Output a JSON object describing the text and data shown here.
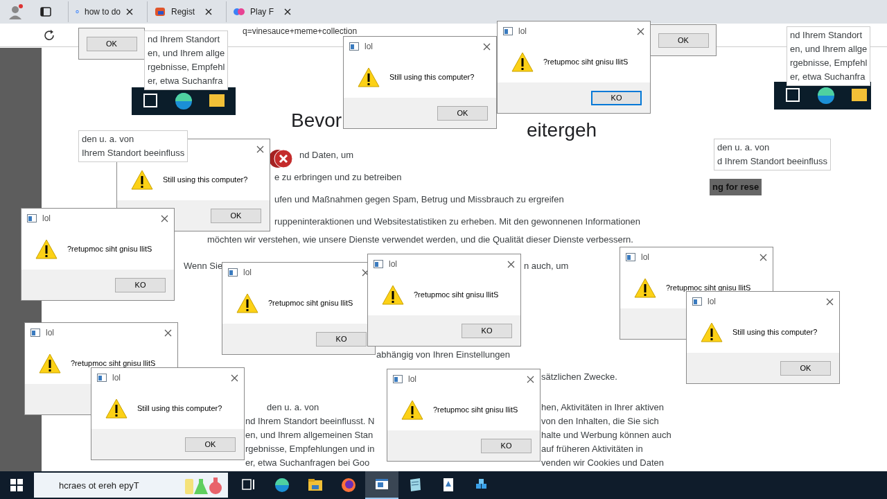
{
  "browser": {
    "tabs": [
      {
        "label": "how to do",
        "selected": false
      },
      {
        "label": "Regist",
        "selected": false
      },
      {
        "label": "Play F",
        "selected": false
      }
    ],
    "address": "q=vinesauce+meme+collection",
    "heading": "Bevor",
    "heading_tail": "eitergeh",
    "page_texts": [
      "nd Daten, um",
      "e zu erbringen und zu betreiben",
      "ufen und Maßnahmen gegen Spam, Betrug und Missbrauch zu ergreifen",
      "ruppeninteraktionen und Websitestatistiken zu erheben. Mit den gewonnenen Informationen",
      "möchten wir verstehen, wie unsere Dienste verwendet werden, und die Qualität dieser Dienste verbessern.",
      "Wenn Sie",
      "n auch, um",
      "abhängig von Ihren Einstellungen",
      "sätzlichen Zwecke.",
      "den u. a. von",
      "hen, Aktivitäten in Ihrer aktiven",
      "nd Ihrem Standort beeinflusst. N",
      "von den Inhalten, die Sie sich",
      "en, und Ihrem allgemeinen Stan",
      "halte und Werbung können auch",
      "rgebnisse, Empfehlungen und in",
      "auf früheren Aktivitäten in",
      "er, etwa Suchanfragen bei Goo",
      "venden wir Cookies und Daten"
    ]
  },
  "dialogs": [
    {
      "title": "lol",
      "message": "?retupmoc siht gnisu llitS",
      "button": "KO",
      "default": true
    },
    {
      "button": "OK",
      "default": false
    },
    {
      "button": "OK",
      "default": false
    },
    {
      "title": "lol",
      "message": "Still using this computer?",
      "button": "OK",
      "default": false
    },
    {
      "message": "Still using this computer?",
      "button": "OK",
      "default": false
    },
    {
      "title": "lol",
      "message": "?retupmoc siht gnisu llitS",
      "button": "KO",
      "default": false
    },
    {
      "title": "lol",
      "message": "?retupmoc siht gnisu llitS",
      "button": "KO",
      "default": false
    },
    {
      "title": "lol",
      "message": "?retupmoc siht gnisu llitS",
      "button": "KO",
      "default": false
    },
    {
      "title": "lol",
      "message": "?retupmoc siht gnisu llitS"
    },
    {
      "title": "lol",
      "message": "?retupmoc siht gnisu llitS"
    },
    {
      "title": "lol",
      "message": "Still using this computer?",
      "button": "OK",
      "default": false
    },
    {
      "title": "lol",
      "message": "Still using this computer?",
      "button": "OK",
      "default": false
    },
    {
      "title": "lol",
      "message": "?retupmoc siht gnisu llitS",
      "button": "KO",
      "default": false
    }
  ],
  "fragments": [
    {
      "lines": [
        "nd Ihrem Standort",
        "en, und Ihrem allge",
        "rgebnisse, Empfehl",
        "er, etwa Suchanfra"
      ]
    },
    {
      "lines": [
        "nd Ihrem Standort",
        "en, und Ihrem allge",
        "rgebnisse, Empfehl",
        "er, etwa Suchanfra"
      ]
    },
    {
      "lines": [
        "den u. a. von",
        "Ihrem Standort beeinfluss"
      ]
    },
    {
      "lines": [
        "den u. a. von",
        "d Ihrem Standort beeinfluss"
      ]
    },
    {
      "lines": [
        "ng for rese"
      ]
    }
  ],
  "taskbar": {
    "search": {
      "placeholder": "hcraes ot ereh epyT"
    },
    "apps": [
      {
        "kind": "taskview",
        "selected": false
      },
      {
        "kind": "edge",
        "selected": false
      },
      {
        "kind": "folder",
        "selected": false
      },
      {
        "kind": "firefox",
        "selected": false
      },
      {
        "kind": "window",
        "selected": true
      },
      {
        "kind": "notepad",
        "selected": false
      },
      {
        "kind": "document",
        "selected": false
      },
      {
        "kind": "cubes",
        "selected": false
      }
    ]
  }
}
